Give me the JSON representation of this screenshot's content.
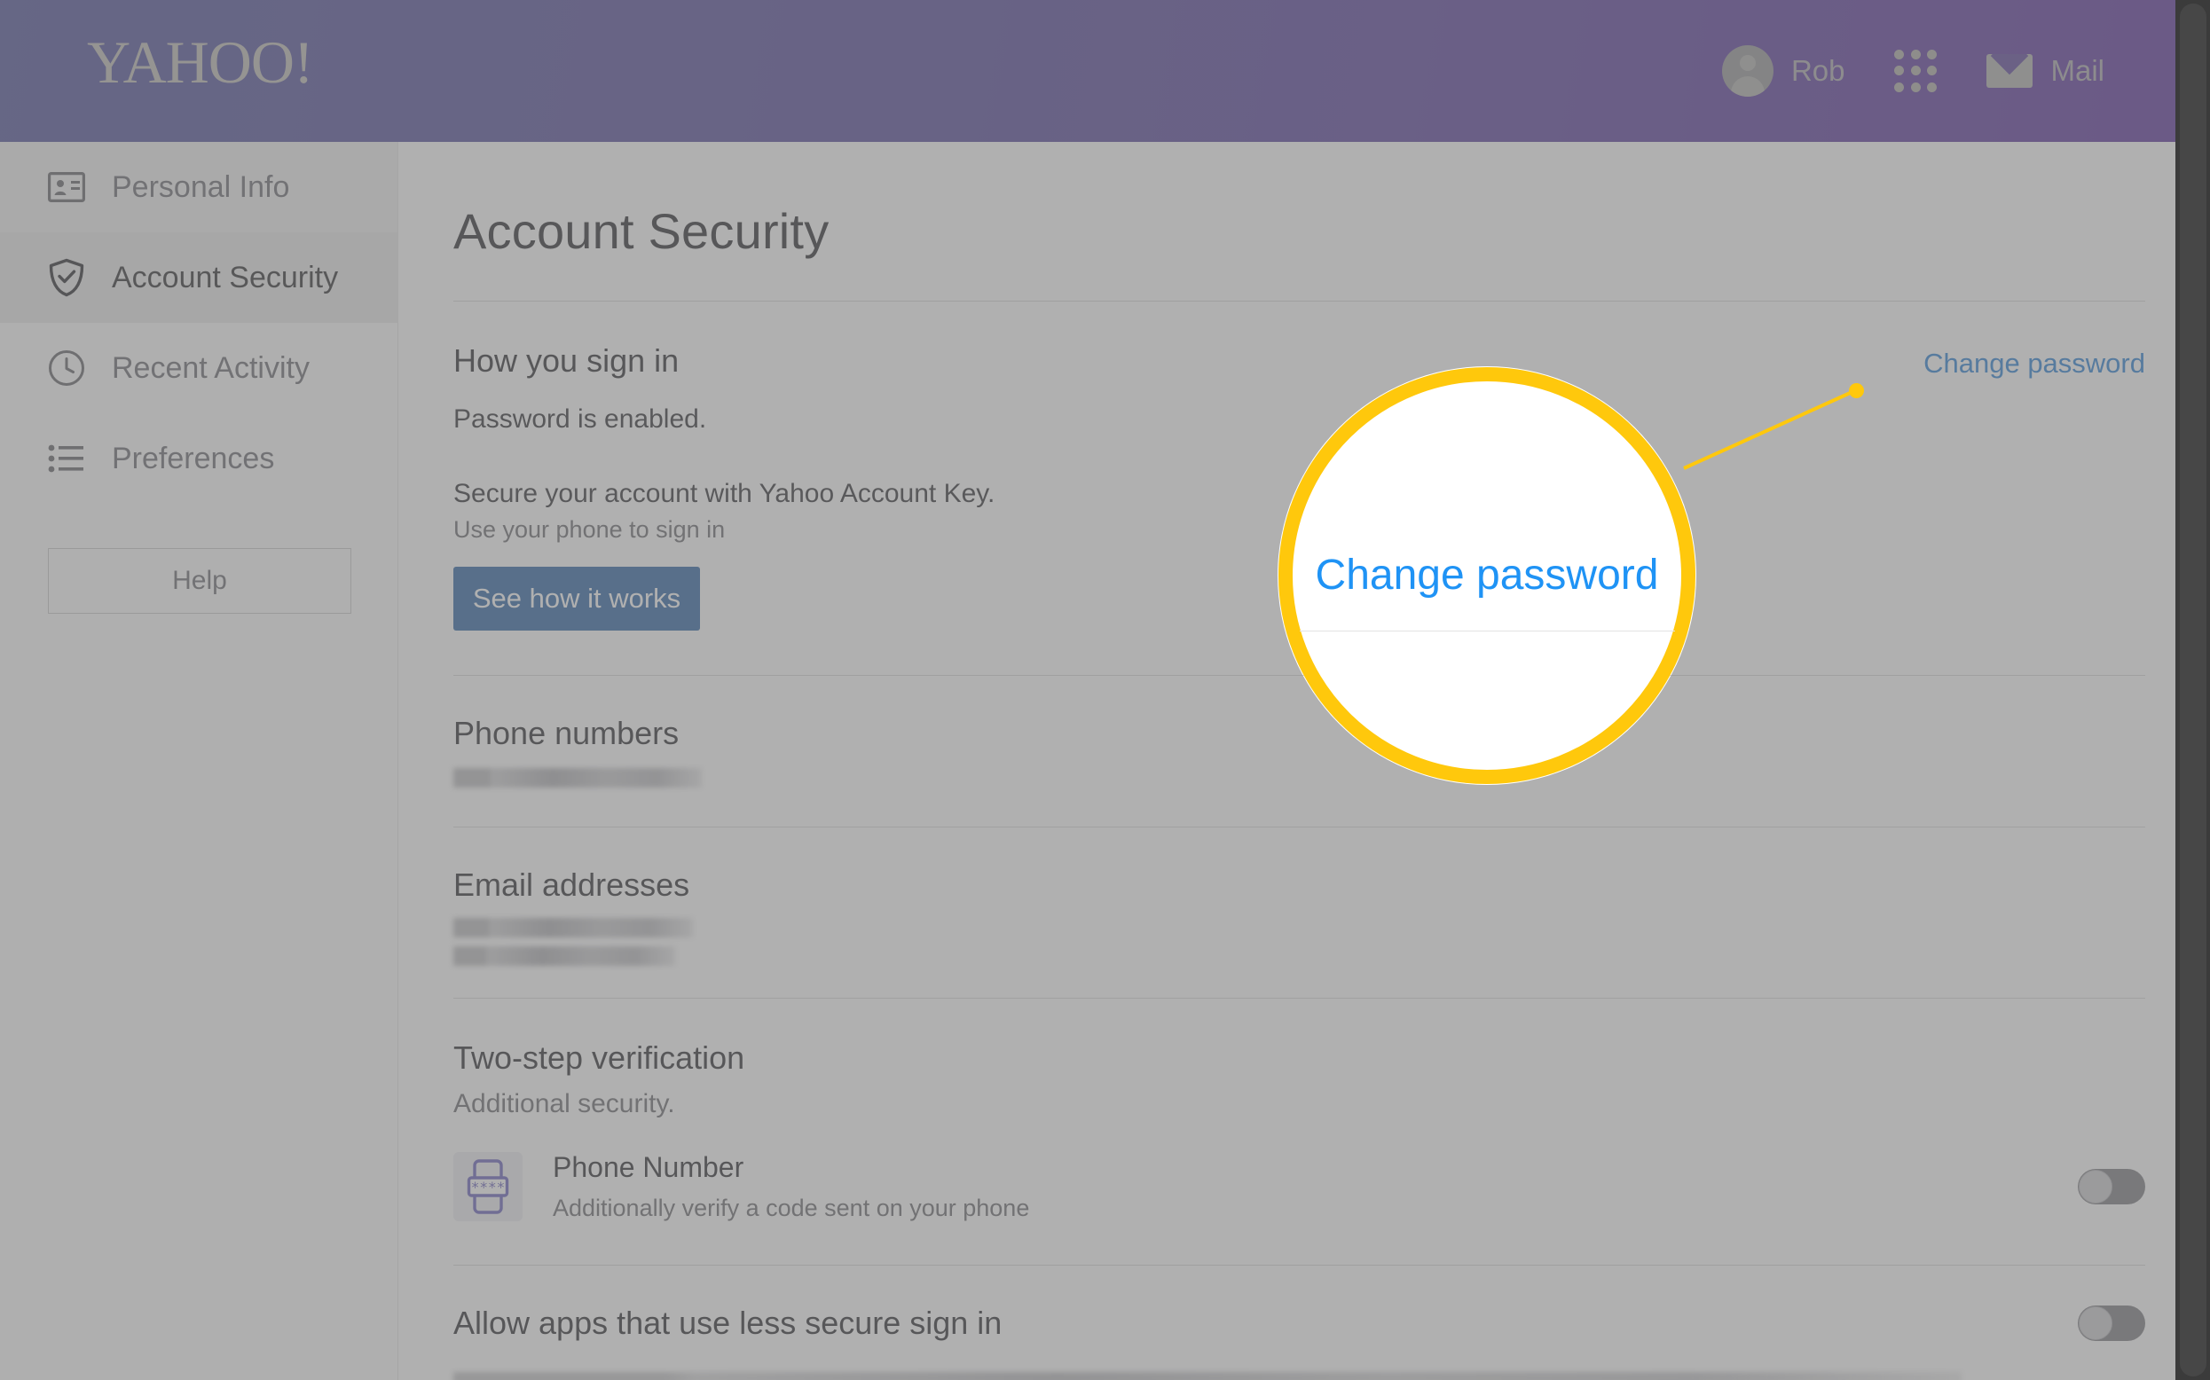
{
  "header": {
    "logo": "YAHOO!",
    "user_name": "Rob",
    "apps_icon": "apps-grid-icon",
    "mail_label": "Mail",
    "mail_icon": "envelope-icon",
    "avatar_icon": "avatar-icon",
    "gradient_from": "#3d3f8f",
    "gradient_to": "#4b1d91"
  },
  "sidebar": {
    "items": [
      {
        "label": "Personal Info",
        "icon": "contact-card-icon",
        "active": false
      },
      {
        "label": "Account Security",
        "icon": "shield-check-icon",
        "active": true
      },
      {
        "label": "Recent Activity",
        "icon": "clock-icon",
        "active": false
      },
      {
        "label": "Preferences",
        "icon": "list-icon",
        "active": false
      }
    ],
    "help_label": "Help"
  },
  "main": {
    "page_title": "Account Security",
    "sections": {
      "sign_in": {
        "title": "How you sign in",
        "status": "Password is enabled.",
        "change_password_link": "Change password"
      },
      "account_key": {
        "title": "Secure your account with Yahoo Account Key.",
        "subtitle": "Use your phone to sign in",
        "button_label": "See how it works",
        "button_color": "#18559c"
      },
      "phone_numbers": {
        "title": "Phone numbers",
        "values_redacted": 1
      },
      "email_addresses": {
        "title": "Email addresses",
        "values_redacted": 2
      },
      "two_step": {
        "title": "Two-step verification",
        "subtitle": "Additional security.",
        "method_title": "Phone Number",
        "method_subtitle": "Additionally verify a code sent on your phone",
        "method_icon": "phone-code-icon",
        "toggle_state": "off"
      },
      "less_secure": {
        "title": "Allow apps that use less secure sign in",
        "toggle_state": "off"
      }
    }
  },
  "callout": {
    "magnified_text": "Change password",
    "magnified_text_color": "#1f93f5",
    "ring_color": "#ffc80c",
    "dot_color": "#ffc80c"
  }
}
